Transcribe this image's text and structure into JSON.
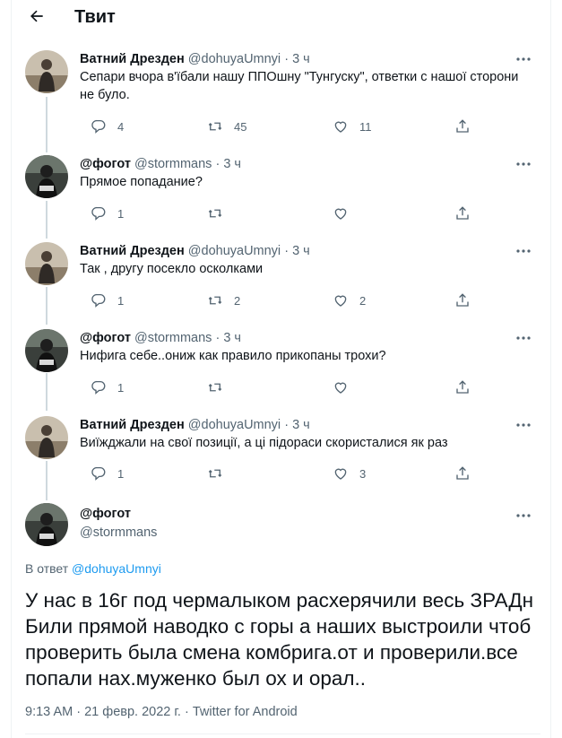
{
  "header": {
    "title": "Твит",
    "back_icon": "arrow-left-icon"
  },
  "thread": [
    {
      "name": "Ватний Дрезден",
      "handle": "@dohuyaUmnyi",
      "dot": "·",
      "time": "3 ч",
      "text": "Сепари вчора в'їбали нашу ППОшну \"Тунгуску\", ответки с нашої сторони не було.",
      "replies": "4",
      "retweets": "45",
      "likes": "11"
    },
    {
      "name": "@фогот",
      "handle": "@stormmans",
      "dot": "·",
      "time": "3 ч",
      "text": "Прямое попадание?",
      "replies": "1",
      "retweets": "",
      "likes": ""
    },
    {
      "name": "Ватний Дрезден",
      "handle": "@dohuyaUmnyi",
      "dot": "·",
      "time": "3 ч",
      "text": "Так , другу посекло осколками",
      "replies": "1",
      "retweets": "2",
      "likes": "2"
    },
    {
      "name": "@фогот",
      "handle": "@stormmans",
      "dot": "·",
      "time": "3 ч",
      "text": "Нифига себе..ониж как правило прикопаны трохи?",
      "replies": "1",
      "retweets": "",
      "likes": ""
    },
    {
      "name": "Ватний Дрезден",
      "handle": "@dohuyaUmnyi",
      "dot": "·",
      "time": "3 ч",
      "text": "Виїжджали на свої позиції, а ці підораси скористалися як раз",
      "replies": "1",
      "retweets": "",
      "likes": "3"
    }
  ],
  "main_tweet": {
    "name": "@фогот",
    "handle": "@stormmans",
    "reply_prefix": "В ответ",
    "reply_to": "@dohuyaUmnyi",
    "text": "У нас в 16г под чермалыком расхерячили весь ЗРАДн Били прямой наводко с горы а наших выстроили чтоб проверить была смена комбрига.от и проверили.все попали нах.муженко был ох и орал..",
    "time": "9:13 AM",
    "date": "21 февр. 2022 г.",
    "source": "Twitter for Android",
    "sep": "·"
  },
  "colors": {
    "text": "#0f1419",
    "secondary": "#536471",
    "link": "#1d9bf0",
    "thread_line": "#cfd9de"
  }
}
